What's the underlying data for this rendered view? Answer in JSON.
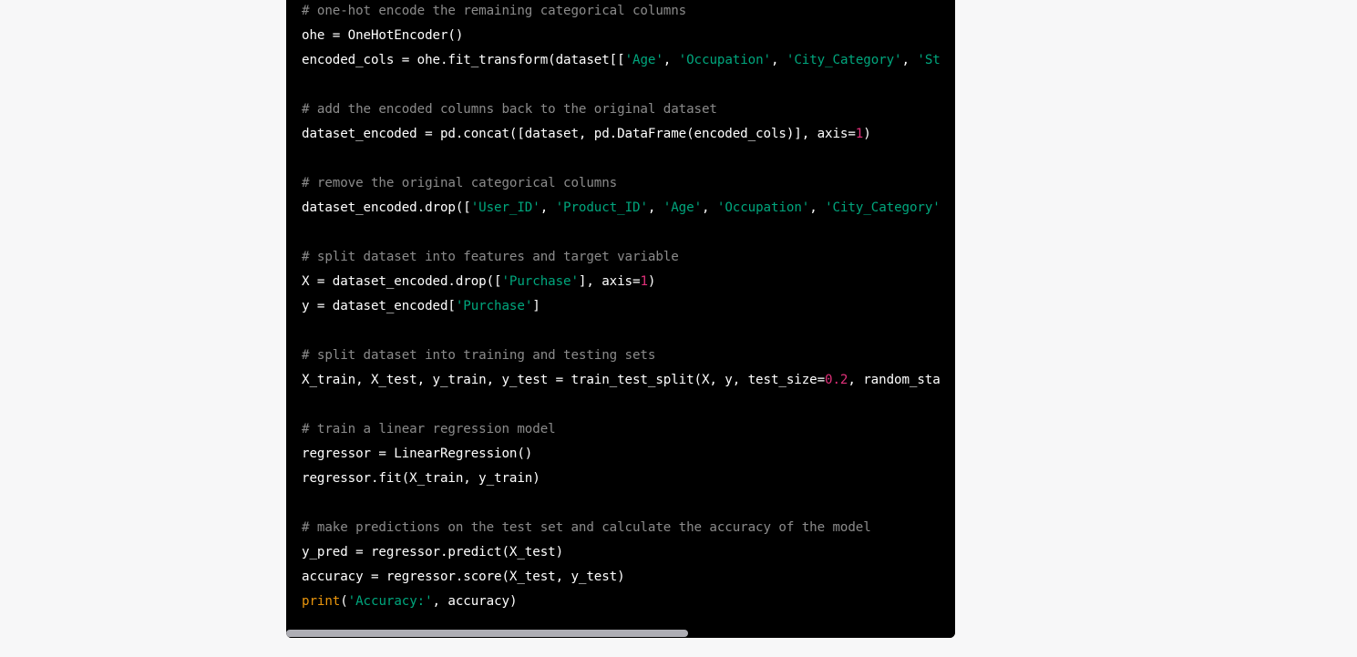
{
  "code_block": {
    "language": "python",
    "lines": [
      [
        {
          "t": "c",
          "v": "# one-hot encode the remaining categorical columns"
        }
      ],
      [
        {
          "t": "p",
          "v": "ohe = OneHotEncoder()"
        }
      ],
      [
        {
          "t": "p",
          "v": "encoded_cols = ohe.fit_transform(dataset[["
        },
        {
          "t": "s",
          "v": "'Age'"
        },
        {
          "t": "p",
          "v": ", "
        },
        {
          "t": "s",
          "v": "'Occupation'"
        },
        {
          "t": "p",
          "v": ", "
        },
        {
          "t": "s",
          "v": "'City_Category'"
        },
        {
          "t": "p",
          "v": ", "
        },
        {
          "t": "s",
          "v": "'St"
        }
      ],
      [],
      [
        {
          "t": "c",
          "v": "# add the encoded columns back to the original dataset"
        }
      ],
      [
        {
          "t": "p",
          "v": "dataset_encoded = pd.concat([dataset, pd.DataFrame(encoded_cols)], axis="
        },
        {
          "t": "n",
          "v": "1"
        },
        {
          "t": "p",
          "v": ")"
        }
      ],
      [],
      [
        {
          "t": "c",
          "v": "# remove the original categorical columns"
        }
      ],
      [
        {
          "t": "p",
          "v": "dataset_encoded.drop(["
        },
        {
          "t": "s",
          "v": "'User_ID'"
        },
        {
          "t": "p",
          "v": ", "
        },
        {
          "t": "s",
          "v": "'Product_ID'"
        },
        {
          "t": "p",
          "v": ", "
        },
        {
          "t": "s",
          "v": "'Age'"
        },
        {
          "t": "p",
          "v": ", "
        },
        {
          "t": "s",
          "v": "'Occupation'"
        },
        {
          "t": "p",
          "v": ", "
        },
        {
          "t": "s",
          "v": "'City_Category'"
        }
      ],
      [],
      [
        {
          "t": "c",
          "v": "# split dataset into features and target variable"
        }
      ],
      [
        {
          "t": "p",
          "v": "X = dataset_encoded.drop(["
        },
        {
          "t": "s",
          "v": "'Purchase'"
        },
        {
          "t": "p",
          "v": "], axis="
        },
        {
          "t": "n",
          "v": "1"
        },
        {
          "t": "p",
          "v": ")"
        }
      ],
      [
        {
          "t": "p",
          "v": "y = dataset_encoded["
        },
        {
          "t": "s",
          "v": "'Purchase'"
        },
        {
          "t": "p",
          "v": "]"
        }
      ],
      [],
      [
        {
          "t": "c",
          "v": "# split dataset into training and testing sets"
        }
      ],
      [
        {
          "t": "p",
          "v": "X_train, X_test, y_train, y_test = train_test_split(X, y, test_size="
        },
        {
          "t": "n",
          "v": "0.2"
        },
        {
          "t": "p",
          "v": ", random_sta"
        }
      ],
      [],
      [
        {
          "t": "c",
          "v": "# train a linear regression model"
        }
      ],
      [
        {
          "t": "p",
          "v": "regressor = LinearRegression()"
        }
      ],
      [
        {
          "t": "p",
          "v": "regressor.fit(X_train, y_train)"
        }
      ],
      [],
      [
        {
          "t": "c",
          "v": "# make predictions on the test set and calculate the accuracy of the model"
        }
      ],
      [
        {
          "t": "p",
          "v": "y_pred = regressor.predict(X_test)"
        }
      ],
      [
        {
          "t": "p",
          "v": "accuracy = regressor.score(X_test, y_test)"
        }
      ],
      [
        {
          "t": "b",
          "v": "print"
        },
        {
          "t": "p",
          "v": "("
        },
        {
          "t": "s",
          "v": "'Accuracy:'"
        },
        {
          "t": "p",
          "v": ", accuracy)"
        }
      ]
    ],
    "horizontal_scroll_fraction": 0.6
  },
  "colors": {
    "background": "#f7f7f8",
    "code_bg": "#000000",
    "comment": "#8b8b8b",
    "string": "#00a67d",
    "number": "#df3079",
    "builtin": "#e9950c"
  }
}
